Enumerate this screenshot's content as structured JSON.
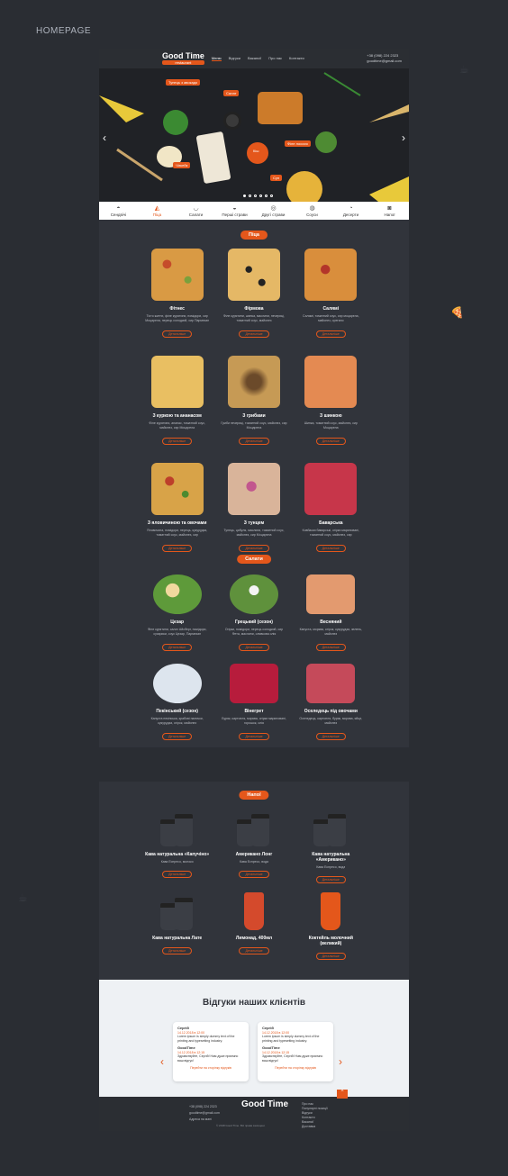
{
  "page_label": "HOMEPAGE",
  "brand": {
    "name": "Good Time",
    "badge": "restaurant"
  },
  "nav": [
    "Меню",
    "Відгуки",
    "Вакансії",
    "Про нас",
    "Контакти"
  ],
  "contacts": {
    "phone": "+38 (098) 224 2323",
    "email": "goodtime@gmail.com"
  },
  "hero_tags": [
    "Тунець з авокадо",
    "Салат",
    "Чізкейк",
    "Кіш",
    "Філе лосося",
    "Суп"
  ],
  "categories": [
    "Сендвічі",
    "Піца",
    "Салати",
    "Перші страви",
    "Другі страви",
    "Соуси",
    "Десерти",
    "Напої"
  ],
  "sections": {
    "pizza": "Піца",
    "salads": "Салати",
    "drinks": "Напої"
  },
  "button_label": "Детальніше",
  "pizzas": [
    {
      "name": "Фітнес",
      "desc": "Тісто житнє, філе курятини, помідори, сир Моцарела, перець солодкий, сир Пармезан"
    },
    {
      "name": "Фірмова",
      "desc": "Філе курятини, шинка, маслини, печериці, томатний соус, майонез"
    },
    {
      "name": "Салямі",
      "desc": "Салямі, томатний соус, сир моцарела, майонез, орегано"
    },
    {
      "name": "З куркою та ананасом",
      "desc": "Філе курятини, ананас, томатний соус, майонез, сир Моцарела"
    },
    {
      "name": "З грибами",
      "desc": "Гриби печериці, томатний соус, майонез, сир Моцарела"
    },
    {
      "name": "З шинкою",
      "desc": "Шинка, томатний соус, майонез, сир Моцарела"
    },
    {
      "name": "З яловичиною та овочами",
      "desc": "Яловичина, помідори, перець, кукурудза, томатний соус, майонез, сир"
    },
    {
      "name": "З тунцем",
      "desc": "Тунець, цибуля, маслини, томатний соус, майонез, сир Моцарела"
    },
    {
      "name": "Баварська",
      "desc": "Ковбаски баварські, огірки мариновані, томатний соус, майонез, сир"
    }
  ],
  "salads": [
    {
      "name": "Цезар",
      "desc": "Філе курятини, салат Айсберг, помідори, сухарики, соус Цезар, Пармезан"
    },
    {
      "name": "Грецький (сезон)",
      "desc": "Огірки, помідори, перець солодкий, сир Фета, маслини, оливкова олія"
    },
    {
      "name": "Весняний",
      "desc": "Капуста, морква, огірок, кукурудза, зелень, майонез"
    },
    {
      "name": "Пекінський (сезон)",
      "desc": "Капуста пекінська, крабові палички, кукурудза, огірок, майонез"
    },
    {
      "name": "Вінегрет",
      "desc": "Буряк, картопля, морква, огірки мариновані, горошок, олія"
    },
    {
      "name": "Оселедець під овочами",
      "desc": "Оселедець, картопля, буряк, морква, яйце, майонез"
    }
  ],
  "drinks": [
    {
      "name": "Кава натуральна «Капучіно»",
      "desc": "Кава Еспресо, молоко"
    },
    {
      "name": "Американо Лонг",
      "desc": "Кава Еспресо, вода"
    },
    {
      "name": "Кава натуральна «Американо»",
      "desc": "Кава Еспресо, вода"
    },
    {
      "name": "Кава натуральна Лате",
      "desc": ""
    },
    {
      "name": "Лимонад, 400мл",
      "desc": ""
    },
    {
      "name": "Коктейль молочний (великий)",
      "desc": ""
    }
  ],
  "reviews": {
    "title": "Відгуки наших клієнтів",
    "items": [
      {
        "name": "Сергій",
        "date": "14.12.2018 в 12:00",
        "text": "Lorem ipsum is simply dummy text of the printing and typesetting industry.",
        "reply_name": "GoodTime",
        "reply_date": "14.12.2018 в 12:15",
        "reply": "Здравствуйте, Сергій! Нам дуже приємно ваш відгук!",
        "link": "Перейти на сторінку відгуків"
      },
      {
        "name": "Сергій",
        "date": "14.12.2018 в 12:00",
        "text": "Lorem ipsum is simply dummy text of the printing and typesetting industry.",
        "reply_name": "GoodTime",
        "reply_date": "14.12.2018 в 12:15",
        "reply": "Здравствуйте, Сергій! Нам дуже приємно ваш відгук!",
        "link": "Перейти на сторінку відгуків"
      }
    ]
  },
  "footer": {
    "phone": "+38 (098) 224 2323",
    "email": "goodtime@gmail.com",
    "address": "Адреса на мапі",
    "links": [
      "Про нас",
      "Популярні позиції",
      "Відгуки",
      "Контакти",
      "Вакансії",
      "Доставка",
      "Хочу співпрацювати",
      "Партнерам"
    ],
    "copyright": "© 2018 Good Time. Всі права захищені."
  },
  "colors": {
    "accent": "#e4571b",
    "bg": "#2a2d33",
    "panel": "#31343b"
  }
}
